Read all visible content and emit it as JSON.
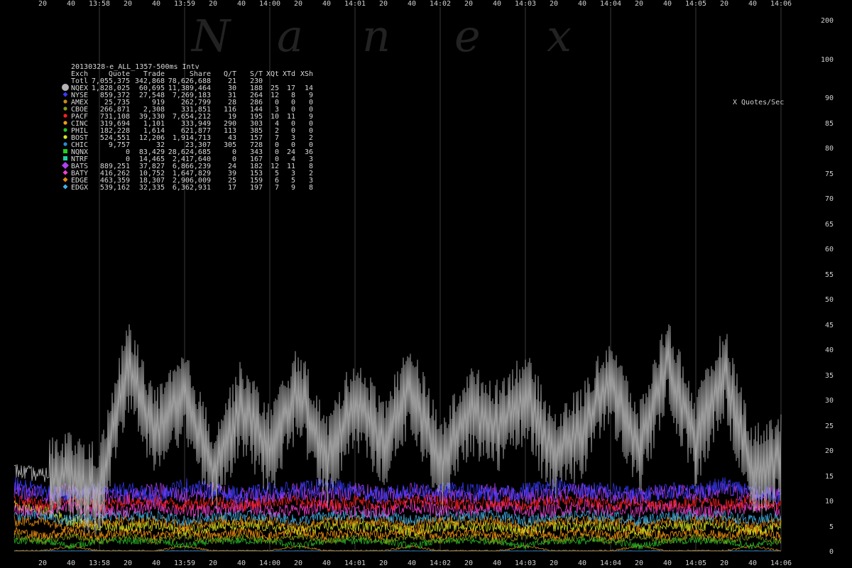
{
  "chart_data": {
    "type": "line",
    "title": "20130328-e_ALL_1357-500ms Intv",
    "watermark": [
      "N",
      "a",
      "n",
      "e",
      "x"
    ],
    "y_unit_label": "X Quotes/Sec",
    "ylim": [
      0,
      200
    ],
    "y_ticks": [
      0,
      5,
      10,
      15,
      20,
      25,
      30,
      35,
      40,
      45,
      50,
      55,
      60,
      65,
      70,
      75,
      80,
      85,
      90,
      100,
      200
    ],
    "y_tick_labels": [
      "0",
      "5",
      "10",
      "15",
      "20",
      "25",
      "30",
      "35",
      "40",
      "45",
      "50",
      "55",
      "60",
      "65",
      "70",
      "75",
      "80",
      "85",
      "90",
      "100",
      "200"
    ],
    "x_range_sec": [
      0,
      540
    ],
    "x_ticks": [
      {
        "t": 20,
        "label": "20"
      },
      {
        "t": 40,
        "label": "40"
      },
      {
        "t": 60,
        "label": "13:58",
        "major": true
      },
      {
        "t": 80,
        "label": "20"
      },
      {
        "t": 100,
        "label": "40"
      },
      {
        "t": 120,
        "label": "13:59",
        "major": true
      },
      {
        "t": 140,
        "label": "20"
      },
      {
        "t": 160,
        "label": "40"
      },
      {
        "t": 180,
        "label": "14:00",
        "major": true
      },
      {
        "t": 200,
        "label": "20"
      },
      {
        "t": 220,
        "label": "40"
      },
      {
        "t": 240,
        "label": "14:01",
        "major": true
      },
      {
        "t": 260,
        "label": "20"
      },
      {
        "t": 280,
        "label": "40"
      },
      {
        "t": 300,
        "label": "14:02",
        "major": true
      },
      {
        "t": 320,
        "label": "20"
      },
      {
        "t": 340,
        "label": "40"
      },
      {
        "t": 360,
        "label": "14:03",
        "major": true
      },
      {
        "t": 380,
        "label": "20"
      },
      {
        "t": 400,
        "label": "40"
      },
      {
        "t": 420,
        "label": "14:04",
        "major": true
      },
      {
        "t": 440,
        "label": "20"
      },
      {
        "t": 460,
        "label": "40"
      },
      {
        "t": 480,
        "label": "14:05",
        "major": true
      },
      {
        "t": 500,
        "label": "20"
      },
      {
        "t": 520,
        "label": "40"
      },
      {
        "t": 540,
        "label": "14:06",
        "major": true
      }
    ],
    "legend_columns": [
      "Exch",
      "Quote",
      "Trade",
      "Share",
      "Q/T",
      "S/T",
      "XQt",
      "XTd",
      "XSh"
    ],
    "legend_rows": [
      {
        "exch": "Totl",
        "quote": "7,055,375",
        "trade": "342,868",
        "share": "78,626,688",
        "qt": "21",
        "st": "230",
        "xqt": "",
        "xtd": "",
        "xsh": "",
        "color": "",
        "marker": "none"
      },
      {
        "exch": "NQEX",
        "quote": "1,828,025",
        "trade": "60,695",
        "share": "11,389,464",
        "qt": "30",
        "st": "188",
        "xqt": "25",
        "xtd": "17",
        "xsh": "14",
        "color": "#b4b4b4",
        "marker": "circle-lg"
      },
      {
        "exch": "NYSE",
        "quote": "859,372",
        "trade": "27,548",
        "share": "7,269,183",
        "qt": "31",
        "st": "264",
        "xqt": "12",
        "xtd": "8",
        "xsh": "9",
        "color": "#3a3aff",
        "marker": "diamond"
      },
      {
        "exch": "AMEX",
        "quote": "25,735",
        "trade": "919",
        "share": "262,799",
        "qt": "28",
        "st": "286",
        "xqt": "0",
        "xtd": "0",
        "xsh": "0",
        "color": "#d08a18",
        "marker": "circle"
      },
      {
        "exch": "CBOE",
        "quote": "266,871",
        "trade": "2,308",
        "share": "331,851",
        "qt": "116",
        "st": "144",
        "xqt": "3",
        "xtd": "0",
        "xsh": "0",
        "color": "#8a9a16",
        "marker": "circle"
      },
      {
        "exch": "PACF",
        "quote": "731,108",
        "trade": "39,330",
        "share": "7,654,212",
        "qt": "19",
        "st": "195",
        "xqt": "10",
        "xtd": "11",
        "xsh": "9",
        "color": "#ff2020",
        "marker": "circle"
      },
      {
        "exch": "CINC",
        "quote": "319,694",
        "trade": "1,101",
        "share": "333,949",
        "qt": "290",
        "st": "303",
        "xqt": "4",
        "xtd": "0",
        "xsh": "0",
        "color": "#ff9a10",
        "marker": "circle"
      },
      {
        "exch": "PHIL",
        "quote": "182,228",
        "trade": "1,614",
        "share": "621,877",
        "qt": "113",
        "st": "385",
        "xqt": "2",
        "xtd": "0",
        "xsh": "0",
        "color": "#28c028",
        "marker": "circle"
      },
      {
        "exch": "BOST",
        "quote": "524,551",
        "trade": "12,206",
        "share": "1,914,713",
        "qt": "43",
        "st": "157",
        "xqt": "7",
        "xtd": "3",
        "xsh": "2",
        "color": "#d8e820",
        "marker": "circle"
      },
      {
        "exch": "CHIC",
        "quote": "9,757",
        "trade": "32",
        "share": "23,307",
        "qt": "305",
        "st": "728",
        "xqt": "0",
        "xtd": "0",
        "xsh": "0",
        "color": "#2a8ad8",
        "marker": "circle"
      },
      {
        "exch": "NQNX",
        "quote": "0",
        "trade": "83,429",
        "share": "28,624,685",
        "qt": "0",
        "st": "343",
        "xqt": "0",
        "xtd": "24",
        "xsh": "36",
        "color": "#20d020",
        "marker": "square"
      },
      {
        "exch": "NTRF",
        "quote": "0",
        "trade": "14,465",
        "share": "2,417,640",
        "qt": "0",
        "st": "167",
        "xqt": "0",
        "xtd": "4",
        "xsh": "3",
        "color": "#20d0a0",
        "marker": "square"
      },
      {
        "exch": "BATS",
        "quote": "889,251",
        "trade": "37,827",
        "share": "6,866,239",
        "qt": "24",
        "st": "182",
        "xqt": "12",
        "xtd": "11",
        "xsh": "8",
        "color": "#b040f0",
        "marker": "diamond-lg"
      },
      {
        "exch": "BATY",
        "quote": "416,262",
        "trade": "10,752",
        "share": "1,647,829",
        "qt": "39",
        "st": "153",
        "xqt": "5",
        "xtd": "3",
        "xsh": "2",
        "color": "#f040d0",
        "marker": "diamond"
      },
      {
        "exch": "EDGE",
        "quote": "463,359",
        "trade": "18,307",
        "share": "2,906,009",
        "qt": "25",
        "st": "159",
        "xqt": "6",
        "xtd": "5",
        "xsh": "3",
        "color": "#e08a10",
        "marker": "diamond"
      },
      {
        "exch": "EDGX",
        "quote": "539,162",
        "trade": "32,335",
        "share": "6,362,931",
        "qt": "17",
        "st": "197",
        "xqt": "7",
        "xtd": "9",
        "xsh": "8",
        "color": "#40b0e8",
        "marker": "diamond"
      }
    ],
    "series": [
      {
        "name": "NQEX",
        "color": "#b4b4b4",
        "base": 24,
        "amp": 9,
        "pattern": "spiky",
        "values": [
          16,
          15,
          17,
          14,
          39,
          25,
          33,
          18,
          31,
          22,
          34,
          20,
          32,
          24,
          35,
          19,
          30,
          27,
          33,
          21,
          26,
          36,
          22,
          40,
          24,
          38,
          18,
          21
        ]
      },
      {
        "name": "NYSE",
        "color": "#3a3aff",
        "base": 11.5,
        "amp": 2.5,
        "pattern": "noise",
        "values": [
          13,
          12,
          11,
          12,
          12,
          11,
          13,
          12,
          11,
          12,
          12,
          13,
          12,
          11,
          12,
          12,
          12,
          11,
          12,
          13,
          12,
          12,
          11,
          12,
          12,
          13,
          12,
          11
        ]
      },
      {
        "name": "BATS",
        "color": "#b040f0",
        "base": 11,
        "amp": 2.5,
        "pattern": "noise",
        "values": [
          12,
          11,
          12,
          11,
          11,
          12,
          11,
          12,
          11,
          11,
          12,
          11,
          12,
          11,
          12,
          11,
          11,
          12,
          11,
          11,
          12,
          11,
          11,
          12,
          11,
          12,
          11,
          12
        ]
      },
      {
        "name": "PACF",
        "color": "#ff2020",
        "base": 9.5,
        "amp": 1.8,
        "pattern": "noise",
        "values": [
          10,
          9,
          10,
          9,
          10,
          10,
          9,
          10,
          9,
          10,
          10,
          9,
          10,
          9,
          10,
          10,
          9,
          10,
          9,
          10,
          10,
          9,
          10,
          9,
          10,
          9,
          10,
          9
        ]
      },
      {
        "name": "BATY",
        "color": "#f040d0",
        "base": 8,
        "amp": 2,
        "pattern": "noise",
        "values": [
          8,
          8,
          9,
          8,
          8,
          9,
          8,
          8,
          9,
          8,
          8,
          9,
          8,
          8,
          9,
          8,
          8,
          9,
          8,
          8,
          9,
          8,
          8,
          9,
          8,
          8,
          9,
          8
        ]
      },
      {
        "name": "EDGX",
        "color": "#40b0e8",
        "base": 7,
        "amp": 1.6,
        "pattern": "noise",
        "values": [
          7,
          7,
          6,
          7,
          7,
          7,
          6,
          7,
          7,
          7,
          6,
          7,
          7,
          7,
          6,
          7,
          7,
          7,
          6,
          7,
          7,
          7,
          6,
          7,
          7,
          7,
          6,
          7
        ]
      },
      {
        "name": "EDGE",
        "color": "#e08a10",
        "base": 6,
        "amp": 1.6,
        "pattern": "noise",
        "values": [
          6,
          6,
          5,
          6,
          6,
          6,
          5,
          6,
          6,
          6,
          5,
          6,
          6,
          6,
          5,
          6,
          6,
          6,
          5,
          6,
          6,
          6,
          5,
          6,
          6,
          6,
          5,
          6
        ]
      },
      {
        "name": "BOST",
        "color": "#d8e820",
        "base": 5,
        "amp": 1.6,
        "pattern": "noise",
        "values": [
          9,
          8,
          6,
          5,
          5,
          5,
          4,
          5,
          5,
          5,
          4,
          5,
          5,
          5,
          4,
          5,
          5,
          5,
          4,
          5,
          5,
          5,
          4,
          5,
          5,
          5,
          4,
          5
        ]
      },
      {
        "name": "CINC",
        "color": "#ff9a10",
        "base": 3.5,
        "amp": 1.3,
        "pattern": "noise",
        "values": [
          4,
          3,
          4,
          3,
          4,
          3,
          4,
          3,
          4,
          3,
          4,
          3,
          4,
          3,
          4,
          3,
          4,
          3,
          4,
          3,
          4,
          3,
          4,
          3,
          4,
          3,
          4,
          3
        ]
      },
      {
        "name": "CBOE",
        "color": "#8a9a16",
        "base": 2.5,
        "amp": 1,
        "pattern": "noise",
        "values": [
          3,
          2,
          3,
          2,
          3,
          2,
          3,
          2,
          3,
          2,
          3,
          2,
          3,
          2,
          3,
          2,
          3,
          2,
          3,
          2,
          3,
          2,
          3,
          2,
          3,
          2,
          3,
          2
        ]
      },
      {
        "name": "PHIL",
        "color": "#28c028",
        "base": 1.8,
        "amp": 1,
        "pattern": "noise",
        "values": [
          2,
          2,
          1,
          2,
          2,
          2,
          1,
          2,
          2,
          2,
          1,
          2,
          2,
          2,
          1,
          2,
          2,
          2,
          1,
          2,
          2,
          2,
          1,
          2,
          2,
          2,
          1,
          2
        ]
      },
      {
        "name": "AMEX",
        "color": "#d08a18",
        "base": 0.4,
        "amp": 0.3,
        "pattern": "noise",
        "values": [
          0,
          0,
          1,
          0,
          0,
          0,
          1,
          0,
          0,
          0,
          1,
          0,
          0,
          0,
          1,
          0,
          0,
          0,
          1,
          0,
          0,
          0,
          1,
          0,
          0,
          0,
          1,
          0
        ]
      },
      {
        "name": "CHIC",
        "color": "#2a8ad8",
        "base": 0.1,
        "amp": 0.15,
        "pattern": "noise",
        "values": [
          0,
          0,
          0,
          0,
          0,
          0,
          0,
          0,
          0,
          0,
          0,
          0,
          0,
          0,
          0,
          0,
          0,
          0,
          0,
          0,
          0,
          0,
          0,
          0,
          0,
          0,
          0,
          0
        ]
      }
    ],
    "grid": true,
    "legend_position": "top-left"
  }
}
